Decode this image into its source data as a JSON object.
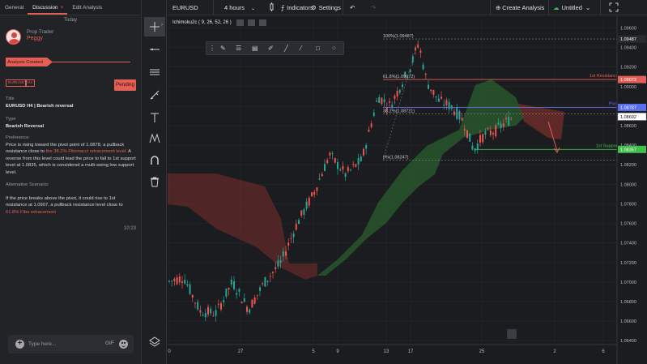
{
  "panel": {
    "tabs": [
      "General",
      "Discussion",
      "Edit Analysis"
    ],
    "close_glyph": "×",
    "day_label": "Today",
    "user_role": "Prop Trader",
    "user_name": "Peggy",
    "status_label": "Analysis Created",
    "tags": [
      "EURUSD",
      "H4"
    ],
    "status_badge": "Pending",
    "title_label": "Title",
    "title_value": "EURUSD H4 | Bearish reversal",
    "type_label": "Type",
    "type_value": "Bearish Reversal",
    "preference_label": "Preference:",
    "preference_text_1": "Price is rising toward the pivot point of 1.0878, a pullback resistance close to ",
    "preference_highlight": "the 38.2% Fibonacci retracement level.",
    "preference_text_2": " A reverse from this level could lead the price to fall to 1st support level at 1.0835, which is considered a multi-swing low support level.",
    "alternative_label": "Alternative Scenario:",
    "alternative_text_1": "If the price breaks above the pivot, it could rise to 1st resistance at  1.0907, a pullback resistance level close to ",
    "alternative_highlight": "61.8% Fibo retracement",
    "message_time": "10:23",
    "input_placeholder": "Type here...",
    "gif_label": "GIF"
  },
  "toolbar": {
    "symbol": "EURUSD",
    "interval": "4 hours",
    "indicators_label": "Indicators",
    "settings_label": "Settings",
    "create_label": "Create Analysis",
    "untitled_label": "Untitled"
  },
  "indicator": {
    "label": "Ichimoku2c ( 9, 26, 52, 26 )"
  },
  "tool_icons": [
    "crosshair-icon",
    "horizontal-line-icon",
    "channel-icon",
    "brush-icon",
    "text-icon",
    "pattern-icon",
    "magnet-icon",
    "trash-icon",
    "layers-icon"
  ],
  "colors": {
    "accent": "#e35f55",
    "up_candle": "#26a69a",
    "down_candle": "#ef5350",
    "pivot": "#5b6ef0",
    "resistance": "#e35f55",
    "support": "#3fbf4a",
    "cloud_bull": "#2f7d32",
    "cloud_bear": "#7a2f2a"
  },
  "chart_data": {
    "type": "candlestick",
    "symbol": "EURUSD",
    "timeframe": "4 hours",
    "x_ticks": [
      "0",
      "27",
      "5",
      "9",
      "13",
      "17",
      "25",
      "2",
      "6"
    ],
    "y_ticks": [
      "1.09600",
      "1.09400",
      "1.09200",
      "1.09000",
      "1.08800",
      "1.08600",
      "1.08400",
      "1.08200",
      "1.08000",
      "1.07800",
      "1.07600",
      "1.07400",
      "1.07200",
      "1.07000",
      "1.06800",
      "1.06600",
      "1.06400"
    ],
    "ylim": [
      1.0636,
      1.0972
    ],
    "price_labels": [
      {
        "text": "1.09487",
        "value": 1.09487,
        "color": "#2a2b30"
      },
      {
        "text": "1.09072",
        "value": 1.09072,
        "color": "#e35f55"
      },
      {
        "text": "1.08787",
        "value": 1.08787,
        "color": "#5b6ef0"
      },
      {
        "text": "1.08692",
        "value": 1.08692,
        "color": "#ffffff"
      },
      {
        "text": "1.08357",
        "value": 1.08357,
        "color": "#3fbf4a"
      }
    ],
    "levels": [
      {
        "name": "1st Resistance",
        "value": 1.09072,
        "color": "#e35f55"
      },
      {
        "name": "Pivot",
        "value": 1.08787,
        "color": "#5b6ef0"
      },
      {
        "name": "1st Support",
        "value": 1.08357,
        "color": "#3fbf4a"
      }
    ],
    "fib_labels": [
      {
        "text": "100%(1.09487)",
        "value": 1.09487
      },
      {
        "text": "61.8%(1.09072)",
        "value": 1.09072
      },
      {
        "text": "38.2%(1.08721)",
        "value": 1.08721
      },
      {
        "text": "0%(1.08247)",
        "value": 1.08247
      }
    ]
  }
}
